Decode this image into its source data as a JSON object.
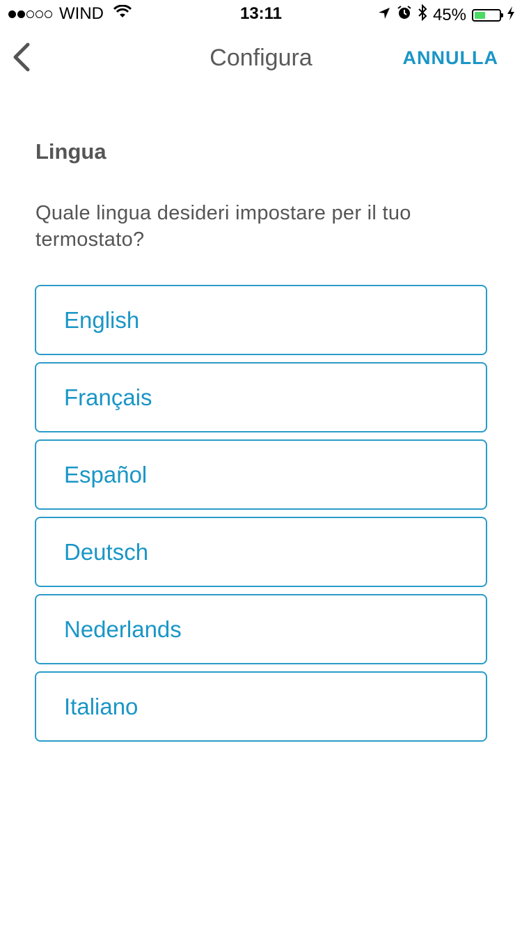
{
  "status_bar": {
    "carrier": "WIND",
    "time": "13:11",
    "battery_percent": "45%",
    "battery_level": 0.45,
    "signal_bars_filled": 2,
    "signal_bars_total": 5,
    "icons": [
      "wifi-icon",
      "location-arrow-icon",
      "alarm-icon",
      "bluetooth-icon",
      "charging-bolt-icon"
    ]
  },
  "nav": {
    "back_icon": "chevron-left-icon",
    "title": "Configura",
    "cancel_label": "ANNULLA"
  },
  "content": {
    "section_title": "Lingua",
    "question": "Quale lingua desideri impostare per il tuo termostato?",
    "languages": [
      "English",
      "Français",
      "Español",
      "Deutsch",
      "Nederlands",
      "Italiano"
    ]
  },
  "colors": {
    "accent": "#1a96c6",
    "text": "#555555",
    "battery": "#4cd964"
  }
}
